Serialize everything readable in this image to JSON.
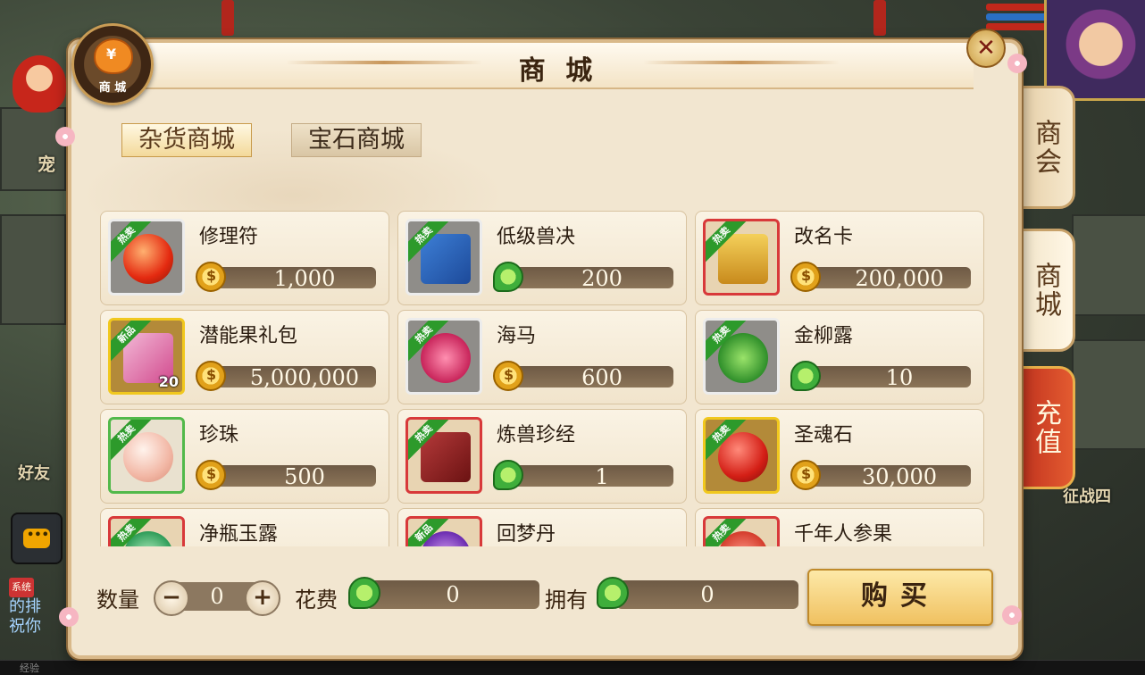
{
  "panel": {
    "title": "商 城",
    "badge_label": "商 城",
    "close_glyph": "✕"
  },
  "category_tabs": [
    {
      "label": "杂货商城",
      "active": true
    },
    {
      "label": "宝石商城",
      "active": false
    }
  ],
  "side_tabs": [
    {
      "label": "商会"
    },
    {
      "label": "商城"
    },
    {
      "label": "充值"
    }
  ],
  "items": [
    {
      "name": "修理符",
      "price": "1,000",
      "currency": "gold-coin-icon",
      "tag": "热卖",
      "frame": "white"
    },
    {
      "name": "低级兽决",
      "price": "200",
      "currency": "jade-icon",
      "tag": "热卖",
      "frame": "white"
    },
    {
      "name": "改名卡",
      "price": "200,000",
      "currency": "gold-coin-icon",
      "tag": "热卖",
      "frame": "red"
    },
    {
      "name": "潜能果礼包",
      "price": "5,000,000",
      "currency": "gold-coin-icon",
      "tag": "新品",
      "frame": "gold",
      "qty": "20"
    },
    {
      "name": "海马",
      "price": "600",
      "currency": "gold-coin-icon",
      "tag": "热卖",
      "frame": "white"
    },
    {
      "name": "金柳露",
      "price": "10",
      "currency": "jade-icon",
      "tag": "热卖",
      "frame": "white"
    },
    {
      "name": "珍珠",
      "price": "500",
      "currency": "gold-coin-icon",
      "tag": "热卖",
      "frame": "green"
    },
    {
      "name": "炼兽珍经",
      "price": "1",
      "currency": "jade-icon",
      "tag": "热卖",
      "frame": "red"
    },
    {
      "name": "圣魂石",
      "price": "30,000",
      "currency": "gold-coin-icon",
      "tag": "热卖",
      "frame": "gold"
    },
    {
      "name": "净瓶玉露",
      "price": "",
      "currency": "",
      "tag": "热卖",
      "frame": "red"
    },
    {
      "name": "回梦丹",
      "price": "",
      "currency": "",
      "tag": "新品",
      "frame": "red"
    },
    {
      "name": "千年人参果",
      "price": "",
      "currency": "",
      "tag": "热卖",
      "frame": "red"
    }
  ],
  "footer": {
    "quantity_label": "数量",
    "quantity_value": "0",
    "minus": "−",
    "plus": "+",
    "cost_label": "花费",
    "cost_value": "0",
    "own_label": "拥有",
    "own_value": "0",
    "buy_label": "购买"
  },
  "background": {
    "chat_tag": "系统",
    "chat_line1": "的排",
    "chat_line2": "祝你",
    "friend_text": "好友",
    "side_text": "征战四",
    "left_char": "宠",
    "bottom_label": "经验"
  },
  "colors": {
    "panel_bg": "#f2e6d0",
    "tag_green": "#2d9a2b",
    "recharge_red": "#c0311e",
    "buy_gold": "#f0c160"
  }
}
